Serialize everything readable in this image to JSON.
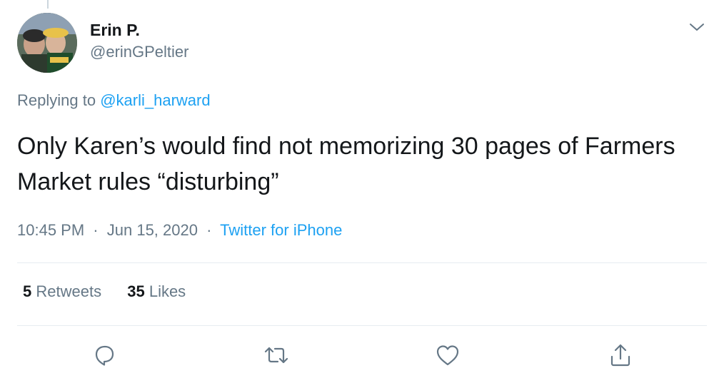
{
  "tweet": {
    "author": {
      "display_name": "Erin P.",
      "handle": "@erinGPeltier"
    },
    "replying_prefix": "Replying to",
    "replying_to": "@karli_harward",
    "text": "Only Karen’s would find not memorizing 30 pages of Farmers Market rules “disturbing”",
    "time": "10:45 PM",
    "date": "Jun 15, 2020",
    "source": "Twitter for iPhone",
    "separator": "·"
  },
  "stats": {
    "retweets_count": "5",
    "retweets_label": "Retweets",
    "likes_count": "35",
    "likes_label": "Likes"
  },
  "actions": {
    "icons": [
      "reply-icon",
      "retweet-icon",
      "like-icon",
      "share-icon"
    ]
  },
  "colors": {
    "text": "#14171a",
    "secondary": "#657786",
    "accent": "#1da1f2",
    "divider": "#e6ecf0"
  }
}
